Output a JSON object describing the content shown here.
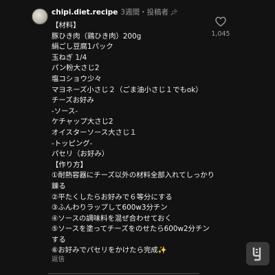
{
  "comment": {
    "username": "chipi.diet.recipe",
    "time": "3週間",
    "separator": "・",
    "author_tag": "投稿者",
    "like_count": "1,045",
    "reply_label": "返信",
    "lines": [
      "【材料】",
      "豚ひき肉（鶏ひき肉）200g",
      "絹ごし豆腐1パック",
      "玉ねぎ 1/4",
      "パン粉大さじ2",
      "塩コショウ少々",
      "マヨネーズ小さじ２（ごま油小さじ１でもok）",
      "チーズお好み",
      "-ソース-",
      "ケチャップ大さじ2",
      "オイスターソース大さじ１",
      "-トッピング-",
      "パセリ（お好み）",
      "【作り方】",
      "①耐熱容器にチーズ以外の材料全部入れてしっかり錬る",
      "②平たくしたらお好みで６等分にする",
      "③ふんわりラップして600w3分チン",
      "④ソースの調味料を混ぜ合わせておく",
      "⑤ソースを塗ってチーズをのせたら600w2分チンする",
      "⑥お好みでパセリをかけたら完成✨"
    ]
  },
  "icons": {
    "pin": "pin-icon",
    "heart": "heart-icon",
    "watermark": "logo-watermark"
  }
}
